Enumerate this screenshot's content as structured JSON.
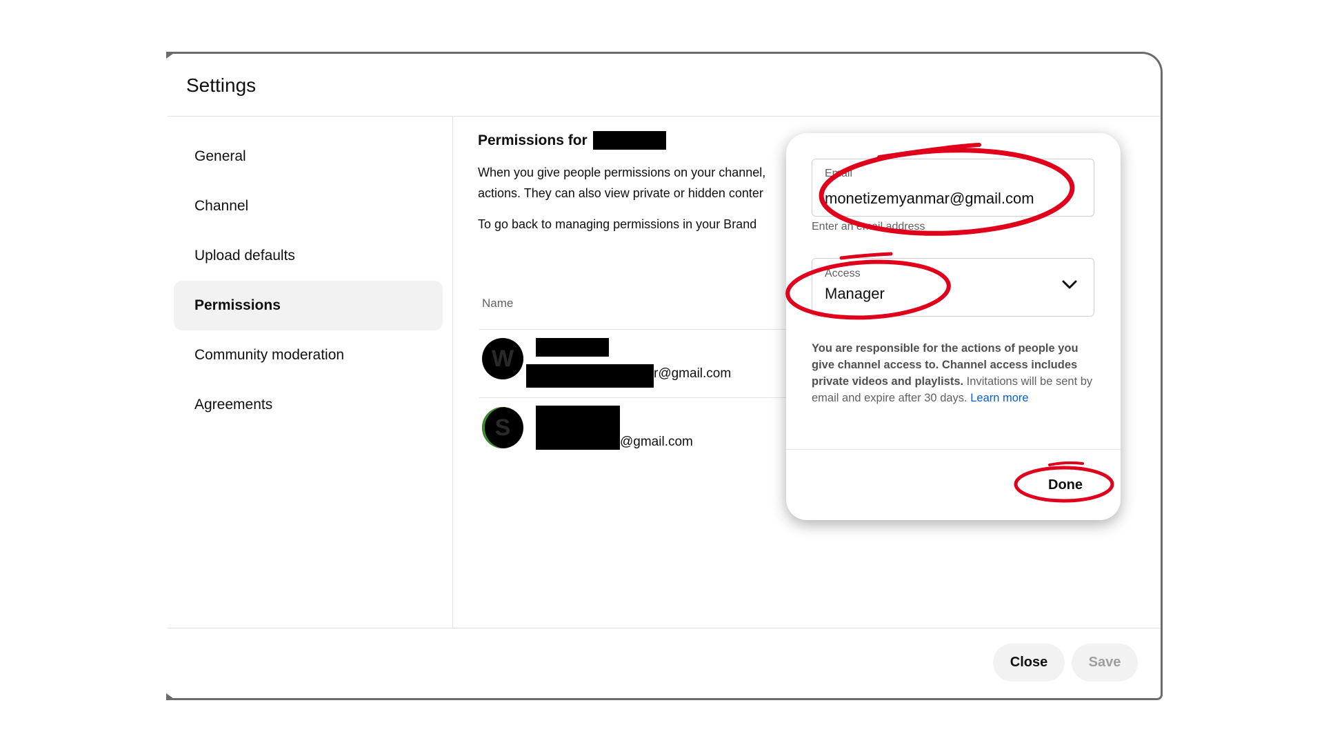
{
  "dialog": {
    "title": "Settings"
  },
  "nav": {
    "items": [
      {
        "label": "General"
      },
      {
        "label": "Channel"
      },
      {
        "label": "Upload defaults"
      },
      {
        "label": "Permissions",
        "active": true
      },
      {
        "label": "Community moderation"
      },
      {
        "label": "Agreements"
      }
    ]
  },
  "main": {
    "title": "Permissions for",
    "description_line1": "When you give people permissions on your channel,",
    "description_line2": "actions. They can also view private or hidden conter",
    "brand_text": "To go back to managing permissions in your Brand",
    "column_name": "Name",
    "users": [
      {
        "avatar_letter": "W",
        "email_suffix": "r@gmail.com"
      },
      {
        "avatar_letter": "S",
        "email_suffix": "@gmail.com"
      }
    ]
  },
  "invite": {
    "email_label": "Email",
    "email_value": "monetizemyanmar@gmail.com",
    "email_helper": "Enter an email address",
    "access_label": "Access",
    "access_value": "Manager",
    "notice_bold": "You are responsible for the actions of people you give channel access to. Channel access includes private videos and playlists.",
    "notice_text": " Invitations will be sent by email and expire after 30 days. ",
    "learn_more": "Learn more",
    "done_label": "Done"
  },
  "footer": {
    "close_label": "Close",
    "save_label": "Save"
  },
  "colors": {
    "annotation": "#e0001b",
    "link": "#065fd4"
  }
}
